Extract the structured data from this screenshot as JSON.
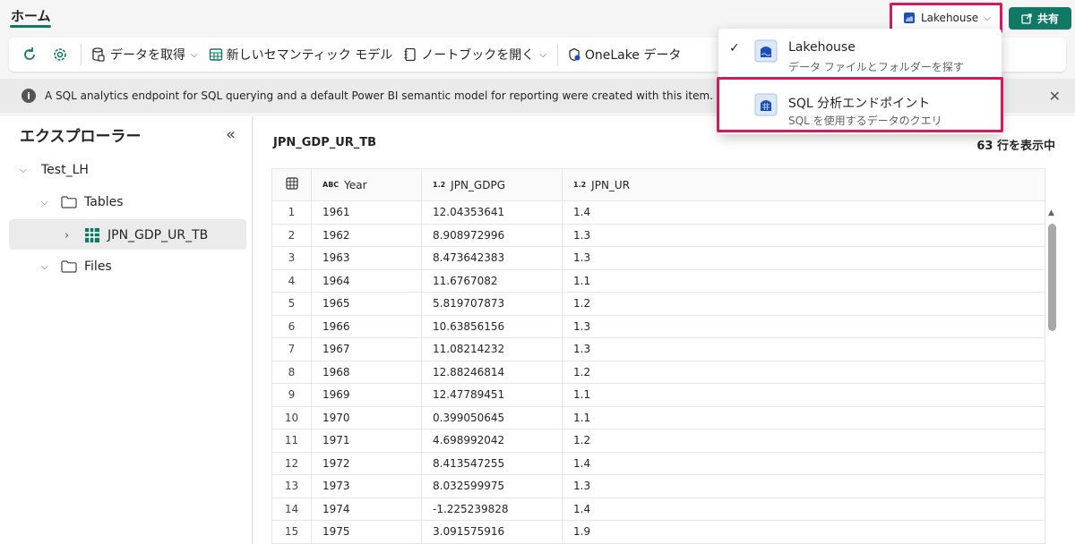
{
  "tabs": {
    "home": "ホーム"
  },
  "switcher": {
    "label": "Lakehouse"
  },
  "share": {
    "label": "共有"
  },
  "toolbar": {
    "get_data": "データを取得",
    "new_model": "新しいセマンティック モデル",
    "open_notebook": "ノートブックを開く",
    "onelake": "OneLake データ"
  },
  "info": {
    "text": "A SQL analytics endpoint for SQL querying and a default Power BI semantic model for reporting were created with this item."
  },
  "explorer": {
    "title": "エクスプローラー",
    "workspace": "Test_LH",
    "tables": "Tables",
    "table_item": "JPN_GDP_UR_TB",
    "files": "Files"
  },
  "main": {
    "title": "JPN_GDP_UR_TB",
    "row_count": "63 行を表示中",
    "columns": [
      {
        "type": "ABC",
        "name": "Year"
      },
      {
        "type": "1.2",
        "name": "JPN_GDPG"
      },
      {
        "type": "1.2",
        "name": "JPN_UR"
      }
    ],
    "rows": [
      [
        "1",
        "1961",
        "12.04353641",
        "1.4"
      ],
      [
        "2",
        "1962",
        "8.908972996",
        "1.3"
      ],
      [
        "3",
        "1963",
        "8.473642383",
        "1.3"
      ],
      [
        "4",
        "1964",
        "11.6767082",
        "1.1"
      ],
      [
        "5",
        "1965",
        "5.819707873",
        "1.2"
      ],
      [
        "6",
        "1966",
        "10.63856156",
        "1.3"
      ],
      [
        "7",
        "1967",
        "11.08214232",
        "1.3"
      ],
      [
        "8",
        "1968",
        "12.88246814",
        "1.2"
      ],
      [
        "9",
        "1969",
        "12.47789451",
        "1.1"
      ],
      [
        "10",
        "1970",
        "0.399050645",
        "1.1"
      ],
      [
        "11",
        "1971",
        "4.698992042",
        "1.2"
      ],
      [
        "12",
        "1972",
        "8.413547255",
        "1.4"
      ],
      [
        "13",
        "1973",
        "8.032599975",
        "1.3"
      ],
      [
        "14",
        "1974",
        "-1.225239828",
        "1.4"
      ],
      [
        "15",
        "1975",
        "3.091575916",
        "1.9"
      ]
    ]
  },
  "dropdown": {
    "items": [
      {
        "title": "Lakehouse",
        "subtitle": "データ ファイルとフォルダーを探す",
        "checked": true
      },
      {
        "title": "SQL 分析エンドポイント",
        "subtitle": "SQL を使用するデータのクエリ",
        "checked": false
      }
    ]
  },
  "colors": {
    "accent": "#117865",
    "highlight": "#d6195f",
    "icon_blue": "#1f4fb0"
  }
}
